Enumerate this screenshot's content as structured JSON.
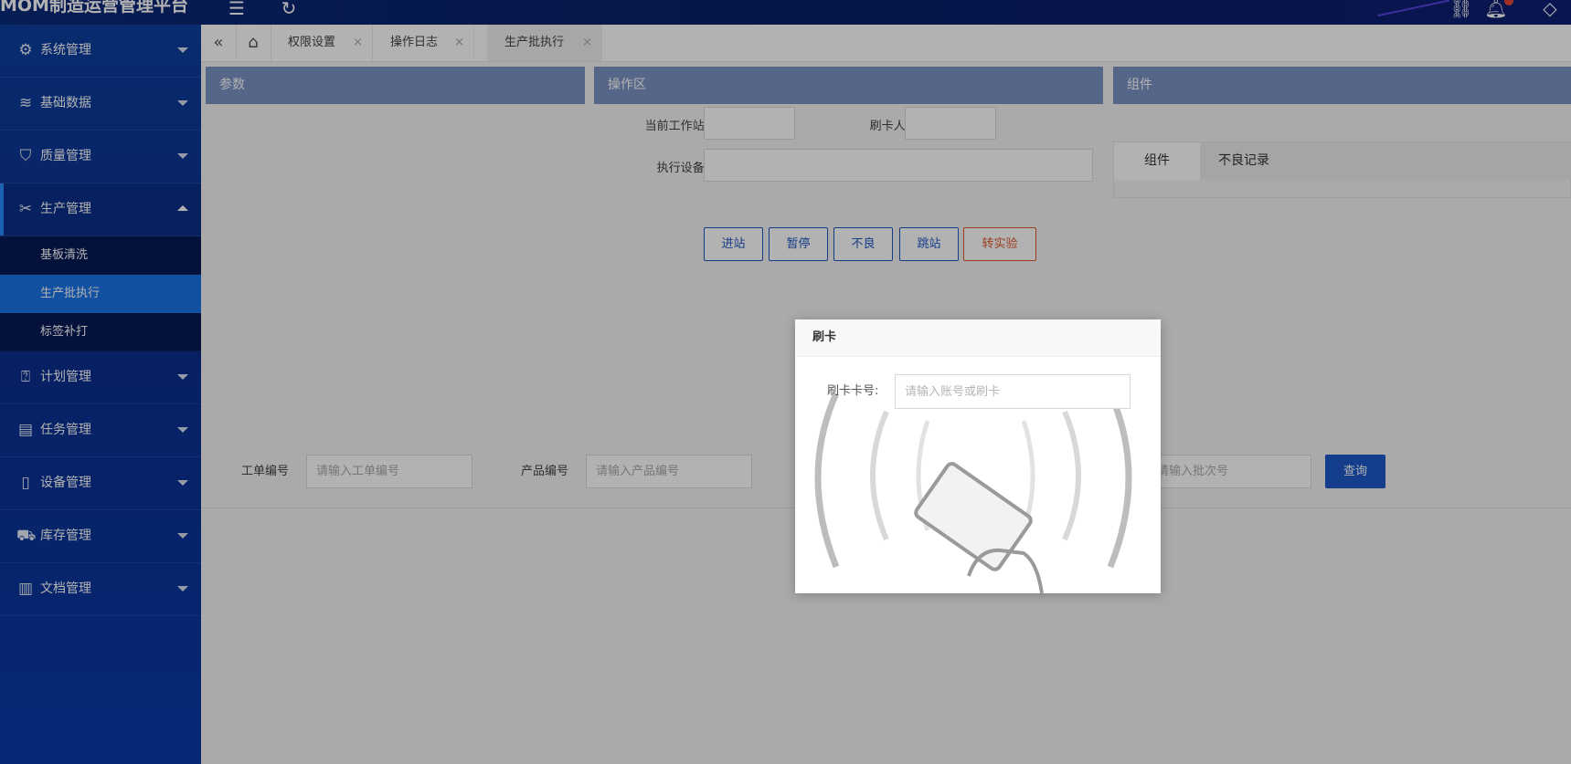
{
  "app": {
    "title": "MOM制造运营管理平台"
  },
  "topbar": {
    "icons": [
      "menu-fold-icon",
      "refresh-icon",
      "link-icon",
      "bell-icon",
      "tag-icon"
    ]
  },
  "sidebar": {
    "items": [
      {
        "label": "系统管理",
        "icon": "gear-icon"
      },
      {
        "label": "基础数据",
        "icon": "layers-icon"
      },
      {
        "label": "质量管理",
        "icon": "shield-icon"
      },
      {
        "label": "生产管理",
        "icon": "tools-icon",
        "open": true,
        "children": [
          {
            "label": "基板清洗"
          },
          {
            "label": "生产批执行",
            "active": true
          },
          {
            "label": "标签补打"
          }
        ]
      },
      {
        "label": "计划管理",
        "icon": "plan-icon"
      },
      {
        "label": "任务管理",
        "icon": "clipboard-icon"
      },
      {
        "label": "设备管理",
        "icon": "tablet-icon"
      },
      {
        "label": "库存管理",
        "icon": "cart-icon"
      },
      {
        "label": "文档管理",
        "icon": "document-icon"
      }
    ]
  },
  "tabs": [
    {
      "label": "权限设置",
      "active": false
    },
    {
      "label": "操作日志",
      "active": false
    },
    {
      "label": "生产批执行",
      "active": true
    }
  ],
  "tab_close_glyph": "×",
  "panels": {
    "params": "参数",
    "operation": "操作区",
    "components": "组件"
  },
  "operation_form": {
    "workstation_label": "当前工作站:",
    "swiper_label": "刷卡人:",
    "device_label": "执行设备:",
    "buttons": [
      "进站",
      "暂停",
      "不良",
      "跳站",
      "转实验"
    ]
  },
  "component_tabs": [
    "组件",
    "不良记录"
  ],
  "search": {
    "work_order_label": "工单编号",
    "work_order_placeholder": "请输入工单编号",
    "product_label": "产品编号",
    "product_placeholder": "请输入产品编号",
    "batch_placeholder": "请输入批次号",
    "query_button": "查询"
  },
  "modal": {
    "title": "刷卡",
    "card_label": "刷卡卡号:",
    "card_placeholder": "请输入账号或刷卡"
  },
  "colors": {
    "primary": "#1e5ac8",
    "danger": "#e0572e",
    "sidebar_bg": "#0b2e8c",
    "sidebar_active": "#1a73e8",
    "panel_head": "#7a93c3"
  }
}
